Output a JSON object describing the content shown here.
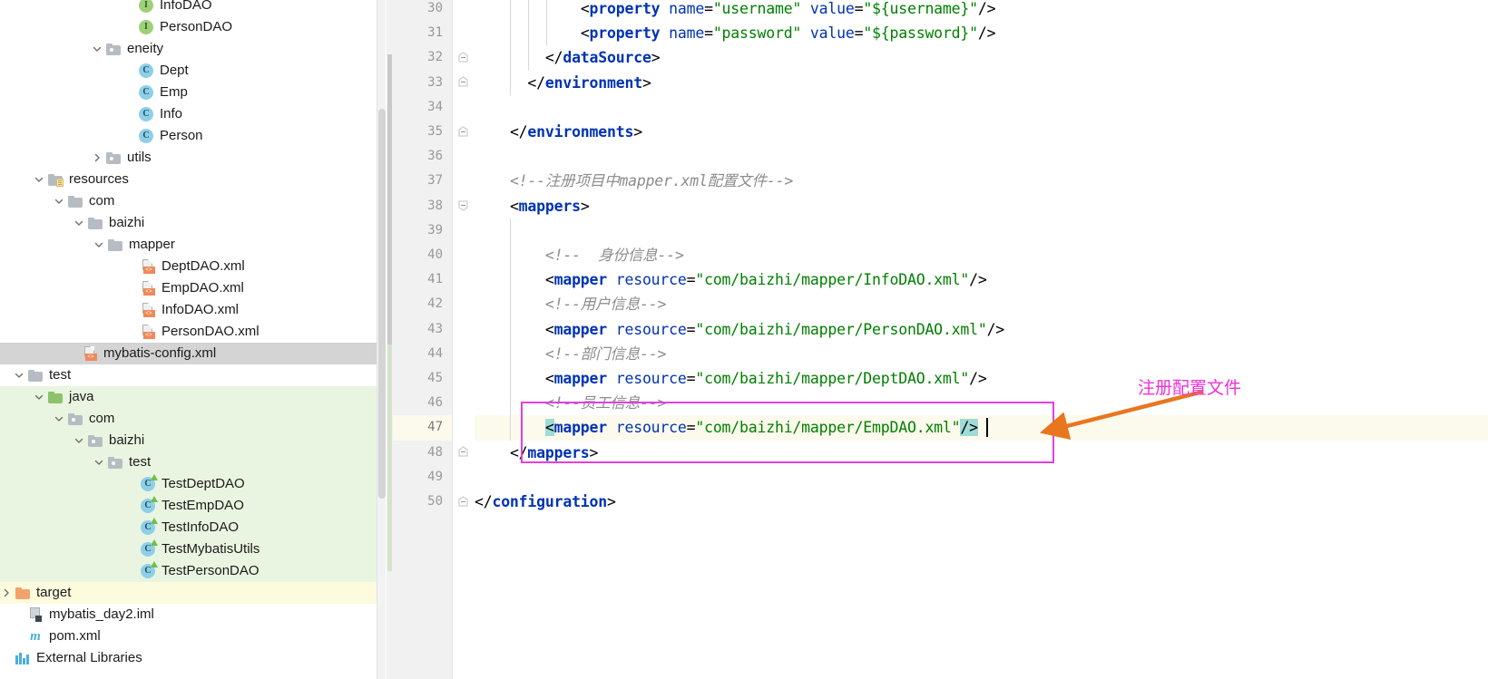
{
  "project_tree": {
    "items": [
      {
        "label": "InfoDAO",
        "icon": "interface-icon",
        "indent": 136,
        "twisty": "none",
        "bg": "none",
        "partial": true
      },
      {
        "label": "PersonDAO",
        "icon": "interface-icon",
        "indent": 136,
        "twisty": "none",
        "bg": "none"
      },
      {
        "label": "eneity",
        "icon": "package-folder-icon",
        "indent": 100,
        "twisty": "expanded",
        "bg": "none"
      },
      {
        "label": "Dept",
        "icon": "class-icon",
        "indent": 136,
        "twisty": "none",
        "bg": "none"
      },
      {
        "label": "Emp",
        "icon": "class-icon",
        "indent": 136,
        "twisty": "none",
        "bg": "none"
      },
      {
        "label": "Info",
        "icon": "class-icon",
        "indent": 136,
        "twisty": "none",
        "bg": "none"
      },
      {
        "label": "Person",
        "icon": "class-icon",
        "indent": 136,
        "twisty": "none",
        "bg": "none"
      },
      {
        "label": "utils",
        "icon": "package-folder-icon",
        "indent": 100,
        "twisty": "collapsed",
        "bg": "none"
      },
      {
        "label": "resources",
        "icon": "resources-folder-icon",
        "indent": 36,
        "twisty": "expanded",
        "bg": "none"
      },
      {
        "label": "com",
        "icon": "folder-icon",
        "indent": 58,
        "twisty": "expanded",
        "bg": "none"
      },
      {
        "label": "baizhi",
        "icon": "folder-icon",
        "indent": 80,
        "twisty": "expanded",
        "bg": "none"
      },
      {
        "label": "mapper",
        "icon": "folder-icon",
        "indent": 102,
        "twisty": "expanded",
        "bg": "none"
      },
      {
        "label": "DeptDAO.xml",
        "icon": "xml-file-icon",
        "indent": 138,
        "twisty": "none",
        "bg": "none"
      },
      {
        "label": "EmpDAO.xml",
        "icon": "xml-file-icon",
        "indent": 138,
        "twisty": "none",
        "bg": "none"
      },
      {
        "label": "InfoDAO.xml",
        "icon": "xml-file-icon",
        "indent": 138,
        "twisty": "none",
        "bg": "none"
      },
      {
        "label": "PersonDAO.xml",
        "icon": "xml-file-icon",
        "indent": 138,
        "twisty": "none",
        "bg": "none"
      },
      {
        "label": "mybatis-config.xml",
        "icon": "xml-file-icon",
        "indent": 74,
        "twisty": "none",
        "bg": "selected"
      },
      {
        "label": "test",
        "icon": "folder-icon",
        "indent": 14,
        "twisty": "expanded",
        "bg": "none"
      },
      {
        "label": "java",
        "icon": "source-folder-icon",
        "indent": 36,
        "twisty": "expanded",
        "bg": "green"
      },
      {
        "label": "com",
        "icon": "package-folder-icon",
        "indent": 58,
        "twisty": "expanded",
        "bg": "green"
      },
      {
        "label": "baizhi",
        "icon": "package-folder-icon",
        "indent": 80,
        "twisty": "expanded",
        "bg": "green"
      },
      {
        "label": "test",
        "icon": "package-folder-icon",
        "indent": 102,
        "twisty": "expanded",
        "bg": "green"
      },
      {
        "label": "TestDeptDAO",
        "icon": "test-class-icon",
        "indent": 138,
        "twisty": "none",
        "bg": "green"
      },
      {
        "label": "TestEmpDAO",
        "icon": "test-class-icon",
        "indent": 138,
        "twisty": "none",
        "bg": "green"
      },
      {
        "label": "TestInfoDAO",
        "icon": "test-class-icon",
        "indent": 138,
        "twisty": "none",
        "bg": "green"
      },
      {
        "label": "TestMybatisUtils",
        "icon": "test-class-icon",
        "indent": 138,
        "twisty": "none",
        "bg": "green"
      },
      {
        "label": "TestPersonDAO",
        "icon": "test-class-icon",
        "indent": 138,
        "twisty": "none",
        "bg": "green"
      },
      {
        "label": "target",
        "icon": "target-folder-icon",
        "indent": 0,
        "twisty": "collapsed",
        "bg": "yellow"
      },
      {
        "label": "mybatis_day2.iml",
        "icon": "iml-file-icon",
        "indent": 14,
        "twisty": "none",
        "bg": "none"
      },
      {
        "label": "pom.xml",
        "icon": "maven-icon",
        "indent": 14,
        "twisty": "none",
        "bg": "none"
      },
      {
        "label": "External Libraries",
        "icon": "external-libraries-icon",
        "indent": 0,
        "twisty": "none",
        "bg": "none",
        "partial_bottom": true
      }
    ]
  },
  "editor": {
    "first_line_number": 30,
    "current_line": 47,
    "lines": [
      {
        "n": 30,
        "fold": "none",
        "indent_guides": [
          2,
          3,
          4
        ],
        "tokens": [
          {
            "t": "            ",
            "c": "t-punct"
          },
          {
            "t": "<",
            "c": "t-punct"
          },
          {
            "t": "property",
            "c": "t-tag"
          },
          {
            "t": " ",
            "c": "t-punct"
          },
          {
            "t": "name",
            "c": "t-attr"
          },
          {
            "t": "=",
            "c": "t-punct"
          },
          {
            "t": "\"username\"",
            "c": "t-val"
          },
          {
            "t": " ",
            "c": "t-punct"
          },
          {
            "t": "value",
            "c": "t-attr"
          },
          {
            "t": "=",
            "c": "t-punct"
          },
          {
            "t": "\"${username}\"",
            "c": "t-val"
          },
          {
            "t": "/>",
            "c": "t-punct"
          }
        ]
      },
      {
        "n": 31,
        "fold": "none",
        "indent_guides": [
          2,
          3,
          4
        ],
        "tokens": [
          {
            "t": "            ",
            "c": "t-punct"
          },
          {
            "t": "<",
            "c": "t-punct"
          },
          {
            "t": "property",
            "c": "t-tag"
          },
          {
            "t": " ",
            "c": "t-punct"
          },
          {
            "t": "name",
            "c": "t-attr"
          },
          {
            "t": "=",
            "c": "t-punct"
          },
          {
            "t": "\"password\"",
            "c": "t-val"
          },
          {
            "t": " ",
            "c": "t-punct"
          },
          {
            "t": "value",
            "c": "t-attr"
          },
          {
            "t": "=",
            "c": "t-punct"
          },
          {
            "t": "\"${password}\"",
            "c": "t-val"
          },
          {
            "t": "/>",
            "c": "t-punct"
          }
        ]
      },
      {
        "n": 32,
        "fold": "end",
        "indent_guides": [
          2,
          3
        ],
        "tokens": [
          {
            "t": "        ",
            "c": "t-punct"
          },
          {
            "t": "</",
            "c": "t-punct"
          },
          {
            "t": "dataSource",
            "c": "t-tag"
          },
          {
            "t": ">",
            "c": "t-punct"
          }
        ]
      },
      {
        "n": 33,
        "fold": "end",
        "indent_guides": [
          2
        ],
        "tokens": [
          {
            "t": "      ",
            "c": "t-punct"
          },
          {
            "t": "</",
            "c": "t-punct"
          },
          {
            "t": "environment",
            "c": "t-tag"
          },
          {
            "t": ">",
            "c": "t-punct"
          }
        ]
      },
      {
        "n": 34,
        "fold": "none",
        "indent_guides": [],
        "tokens": []
      },
      {
        "n": 35,
        "fold": "end",
        "indent_guides": [],
        "tokens": [
          {
            "t": "    ",
            "c": "t-punct"
          },
          {
            "t": "</",
            "c": "t-punct"
          },
          {
            "t": "environments",
            "c": "t-tag"
          },
          {
            "t": ">",
            "c": "t-punct"
          }
        ]
      },
      {
        "n": 36,
        "fold": "none",
        "indent_guides": [],
        "tokens": []
      },
      {
        "n": 37,
        "fold": "none",
        "indent_guides": [],
        "tokens": [
          {
            "t": "    ",
            "c": "t-punct"
          },
          {
            "t": "<!--注册项目中mapper.xml配置文件-->",
            "c": "t-cmt"
          }
        ]
      },
      {
        "n": 38,
        "fold": "start",
        "indent_guides": [],
        "tokens": [
          {
            "t": "    ",
            "c": "t-punct"
          },
          {
            "t": "<",
            "c": "t-punct"
          },
          {
            "t": "mappers",
            "c": "t-tag"
          },
          {
            "t": ">",
            "c": "t-punct"
          }
        ]
      },
      {
        "n": 39,
        "fold": "none",
        "indent_guides": [
          2
        ],
        "tokens": []
      },
      {
        "n": 40,
        "fold": "none",
        "indent_guides": [
          2
        ],
        "tokens": [
          {
            "t": "        ",
            "c": "t-punct"
          },
          {
            "t": "<!--  身份信息-->",
            "c": "t-cmt"
          }
        ]
      },
      {
        "n": 41,
        "fold": "none",
        "indent_guides": [
          2
        ],
        "tokens": [
          {
            "t": "        ",
            "c": "t-punct"
          },
          {
            "t": "<",
            "c": "t-punct"
          },
          {
            "t": "mapper",
            "c": "t-tag"
          },
          {
            "t": " ",
            "c": "t-punct"
          },
          {
            "t": "resource",
            "c": "t-attr"
          },
          {
            "t": "=",
            "c": "t-punct"
          },
          {
            "t": "\"com/baizhi/mapper/InfoDAO.xml\"",
            "c": "t-val"
          },
          {
            "t": "/>",
            "c": "t-punct"
          }
        ]
      },
      {
        "n": 42,
        "fold": "none",
        "indent_guides": [
          2
        ],
        "tokens": [
          {
            "t": "        ",
            "c": "t-punct"
          },
          {
            "t": "<!--用户信息-->",
            "c": "t-cmt"
          }
        ]
      },
      {
        "n": 43,
        "fold": "none",
        "indent_guides": [
          2
        ],
        "tokens": [
          {
            "t": "        ",
            "c": "t-punct"
          },
          {
            "t": "<",
            "c": "t-punct"
          },
          {
            "t": "mapper",
            "c": "t-tag"
          },
          {
            "t": " ",
            "c": "t-punct"
          },
          {
            "t": "resource",
            "c": "t-attr"
          },
          {
            "t": "=",
            "c": "t-punct"
          },
          {
            "t": "\"com/baizhi/mapper/PersonDAO.xml\"",
            "c": "t-val"
          },
          {
            "t": "/>",
            "c": "t-punct"
          }
        ]
      },
      {
        "n": 44,
        "fold": "none",
        "indent_guides": [
          2
        ],
        "tokens": [
          {
            "t": "        ",
            "c": "t-punct"
          },
          {
            "t": "<!--部门信息-->",
            "c": "t-cmt"
          }
        ]
      },
      {
        "n": 45,
        "fold": "none",
        "indent_guides": [
          2
        ],
        "tokens": [
          {
            "t": "        ",
            "c": "t-punct"
          },
          {
            "t": "<",
            "c": "t-punct"
          },
          {
            "t": "mapper",
            "c": "t-tag"
          },
          {
            "t": " ",
            "c": "t-punct"
          },
          {
            "t": "resource",
            "c": "t-attr"
          },
          {
            "t": "=",
            "c": "t-punct"
          },
          {
            "t": "\"com/baizhi/mapper/DeptDAO.xml\"",
            "c": "t-val"
          },
          {
            "t": "/>",
            "c": "t-punct"
          }
        ]
      },
      {
        "n": 46,
        "fold": "none",
        "indent_guides": [
          2
        ],
        "tokens": [
          {
            "t": "        ",
            "c": "t-punct"
          },
          {
            "t": "<!--员工信息-->",
            "c": "t-cmt"
          }
        ]
      },
      {
        "n": 47,
        "fold": "none",
        "indent_guides": [
          2
        ],
        "current": true,
        "tokens": [
          {
            "t": "        ",
            "c": "t-punct"
          },
          {
            "t": "<",
            "c": "t-punct sel"
          },
          {
            "t": "mapper",
            "c": "t-tag"
          },
          {
            "t": " ",
            "c": "t-punct"
          },
          {
            "t": "resource",
            "c": "t-attr"
          },
          {
            "t": "=",
            "c": "t-punct"
          },
          {
            "t": "\"com/baizhi/mapper/EmpDAO.xml\"",
            "c": "t-val"
          },
          {
            "t": "/>",
            "c": "t-punct sel"
          }
        ]
      },
      {
        "n": 48,
        "fold": "end",
        "indent_guides": [],
        "tokens": [
          {
            "t": "    ",
            "c": "t-punct"
          },
          {
            "t": "</",
            "c": "t-punct"
          },
          {
            "t": "mappers",
            "c": "t-tag"
          },
          {
            "t": ">",
            "c": "t-punct"
          }
        ]
      },
      {
        "n": 49,
        "fold": "none",
        "indent_guides": [],
        "tokens": []
      },
      {
        "n": 50,
        "fold": "end",
        "indent_guides": [],
        "tokens": [
          {
            "t": "",
            "c": "t-punct"
          },
          {
            "t": "</",
            "c": "t-punct"
          },
          {
            "t": "configuration",
            "c": "t-tag"
          },
          {
            "t": ">",
            "c": "t-punct"
          }
        ]
      }
    ]
  },
  "annotation": {
    "text": "注册配置文件",
    "box_color": "#e040e0",
    "text_color": "#f030d8",
    "arrow_color": "#e8761f"
  }
}
